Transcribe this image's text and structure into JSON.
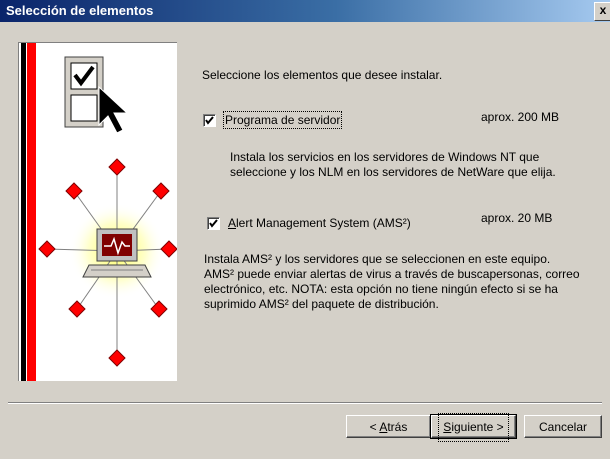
{
  "window": {
    "title": "Selección de elementos",
    "close_glyph": "x"
  },
  "main": {
    "instruction": "Seleccione los elementos que desee instalar.",
    "items": [
      {
        "label": "Programa de servidor",
        "checked": true,
        "size": "aprox. 200 MB",
        "description": "Instala los servicios en los servidores de Windows NT que seleccione y los NLM en los servidores de NetWare que elija."
      },
      {
        "label_pre": "A",
        "label_rest": "lert Management System (AMS²)",
        "checked": true,
        "size": "aprox.  20 MB",
        "description": "Instala AMS² y los servidores que se seleccionen en este equipo. AMS² puede enviar alertas de virus a través de buscapersonas, correo electrónico, etc. NOTA: esta opción no tiene ningún efecto si se ha suprimido AMS² del paquete de distribución."
      }
    ]
  },
  "buttons": {
    "back_pre": "< ",
    "back_ul": "A",
    "back_rest": "trás",
    "next_ul": "S",
    "next_rest": "iguiente >",
    "cancel": "Cancelar"
  },
  "icons": {
    "art": "install-wizard-illustration",
    "close": "close-icon",
    "checkmark": "checkmark-icon"
  },
  "colors": {
    "title_start": "#0a246a",
    "title_end": "#a6caf0",
    "face": "#d4d0c8",
    "accent_red": "#ff0000"
  }
}
